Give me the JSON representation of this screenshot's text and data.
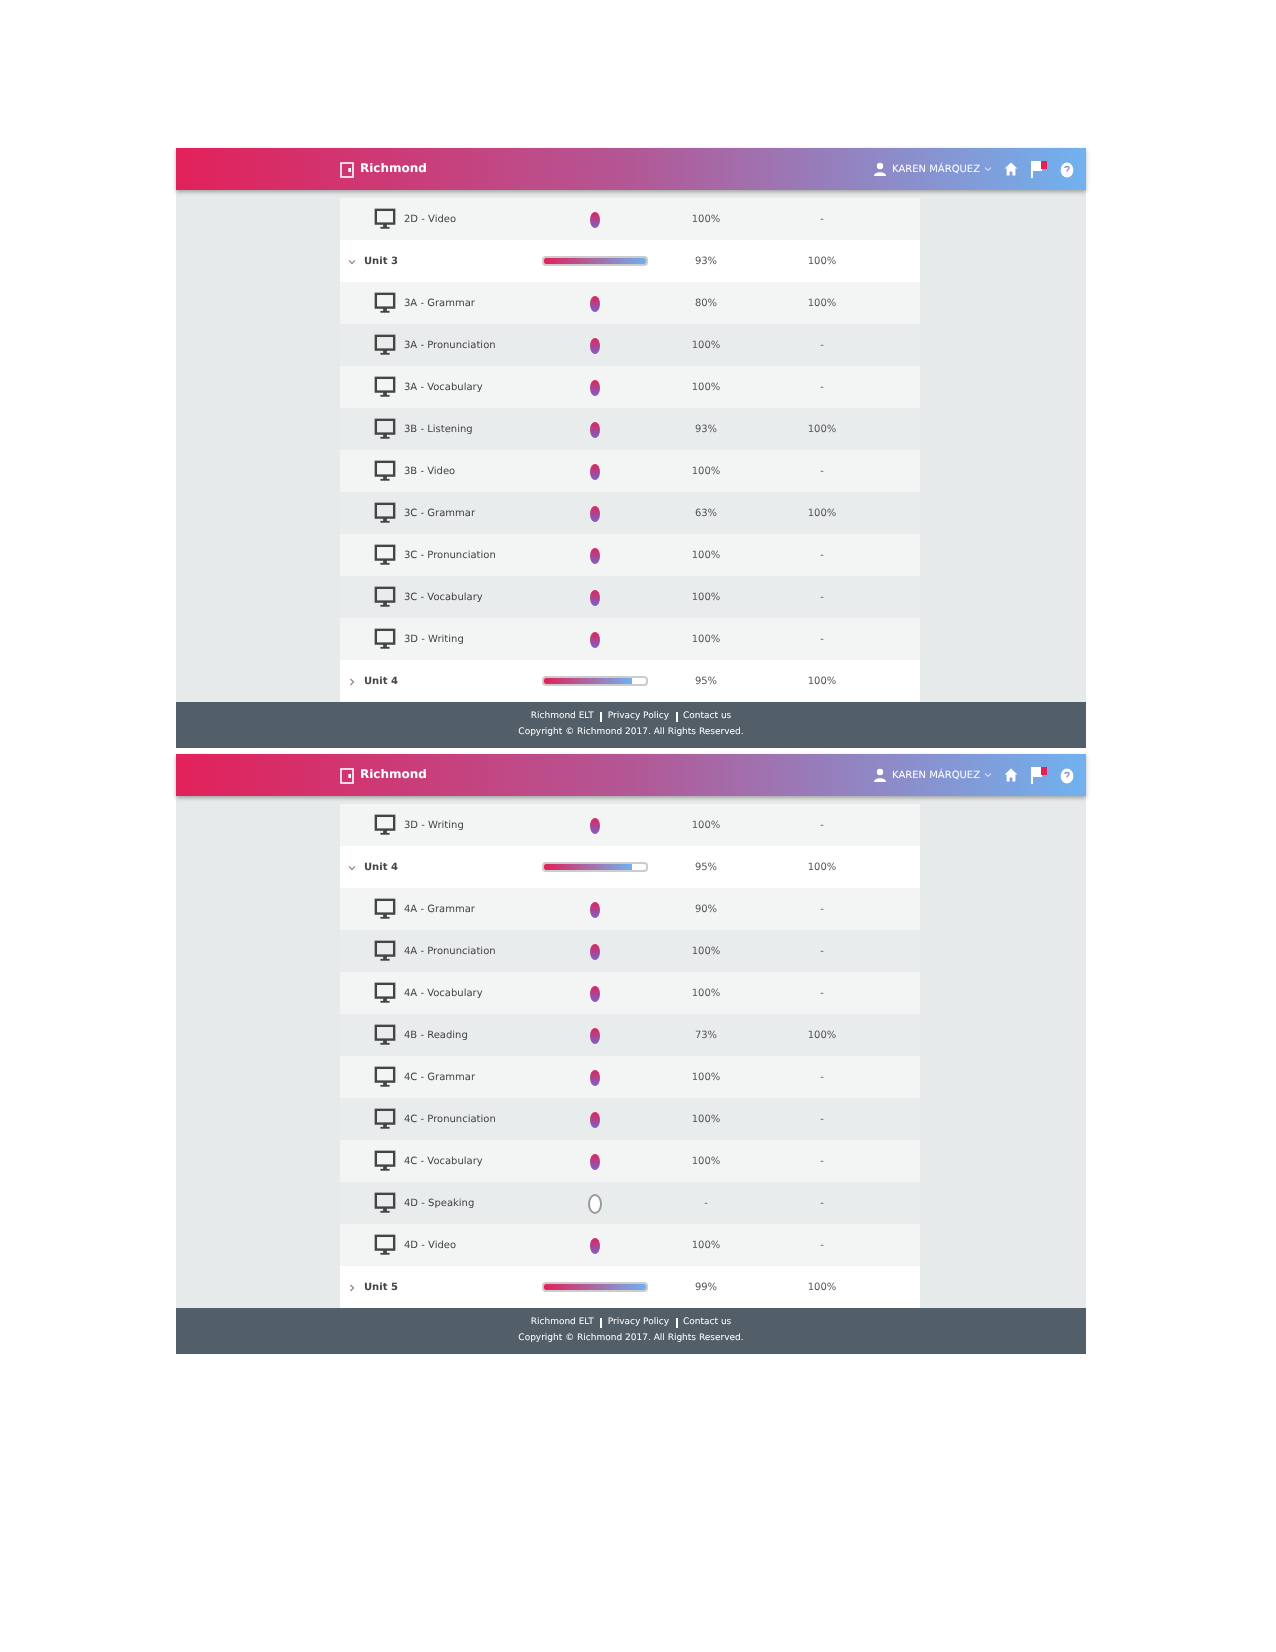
{
  "panels": [
    {
      "header": {
        "brand": "Richmond",
        "user": "KAREN MÁRQUEZ"
      },
      "rows": [
        {
          "kind": "activity",
          "label": "2D - Video",
          "done": true,
          "score": "100%",
          "best": "-"
        },
        {
          "kind": "unit",
          "label": "Unit 3",
          "expanded": true,
          "level": 1,
          "score": "93%",
          "best": "100%"
        },
        {
          "kind": "activity",
          "label": "3A - Grammar",
          "done": true,
          "score": "80%",
          "best": "100%"
        },
        {
          "kind": "activity",
          "label": "3A - Pronunciation",
          "done": true,
          "score": "100%",
          "best": "-"
        },
        {
          "kind": "activity",
          "label": "3A - Vocabulary",
          "done": true,
          "score": "100%",
          "best": "-"
        },
        {
          "kind": "activity",
          "label": "3B - Listening",
          "done": true,
          "score": "93%",
          "best": "100%"
        },
        {
          "kind": "activity",
          "label": "3B - Video",
          "done": true,
          "score": "100%",
          "best": "-"
        },
        {
          "kind": "activity",
          "label": "3C - Grammar",
          "done": true,
          "score": "63%",
          "best": "100%"
        },
        {
          "kind": "activity",
          "label": "3C - Pronunciation",
          "done": true,
          "score": "100%",
          "best": "-"
        },
        {
          "kind": "activity",
          "label": "3C - Vocabulary",
          "done": true,
          "score": "100%",
          "best": "-"
        },
        {
          "kind": "activity",
          "label": "3D - Writing",
          "done": true,
          "score": "100%",
          "best": "-"
        },
        {
          "kind": "unit",
          "label": "Unit 4",
          "expanded": false,
          "level": 0.88,
          "score": "95%",
          "best": "100%"
        }
      ],
      "footer": {
        "links": [
          "Richmond ELT",
          "Privacy Policy",
          "Contact us"
        ],
        "copyright": "Copyright © Richmond 2017. All Rights Reserved."
      }
    },
    {
      "header": {
        "brand": "Richmond",
        "user": "KAREN MÁRQUEZ"
      },
      "rows": [
        {
          "kind": "activity",
          "label": "3D - Writing",
          "done": true,
          "score": "100%",
          "best": "-"
        },
        {
          "kind": "unit",
          "label": "Unit 4",
          "expanded": true,
          "level": 0.88,
          "score": "95%",
          "best": "100%"
        },
        {
          "kind": "activity",
          "label": "4A - Grammar",
          "done": true,
          "score": "90%",
          "best": "-"
        },
        {
          "kind": "activity",
          "label": "4A - Pronunciation",
          "done": true,
          "score": "100%",
          "best": "-"
        },
        {
          "kind": "activity",
          "label": "4A - Vocabulary",
          "done": true,
          "score": "100%",
          "best": "-"
        },
        {
          "kind": "activity",
          "label": "4B - Reading",
          "done": true,
          "score": "73%",
          "best": "100%"
        },
        {
          "kind": "activity",
          "label": "4C - Grammar",
          "done": true,
          "score": "100%",
          "best": "-"
        },
        {
          "kind": "activity",
          "label": "4C - Pronunciation",
          "done": true,
          "score": "100%",
          "best": "-"
        },
        {
          "kind": "activity",
          "label": "4C - Vocabulary",
          "done": true,
          "score": "100%",
          "best": "-"
        },
        {
          "kind": "activity",
          "label": "4D - Speaking",
          "done": false,
          "score": "-",
          "best": "-"
        },
        {
          "kind": "activity",
          "label": "4D - Video",
          "done": true,
          "score": "100%",
          "best": "-"
        },
        {
          "kind": "unit",
          "label": "Unit 5",
          "expanded": false,
          "level": 1,
          "score": "99%",
          "best": "100%"
        }
      ],
      "footer": {
        "links": [
          "Richmond ELT",
          "Privacy Policy",
          "Contact us"
        ],
        "copyright": "Copyright © Richmond 2017. All Rights Reserved."
      }
    }
  ]
}
